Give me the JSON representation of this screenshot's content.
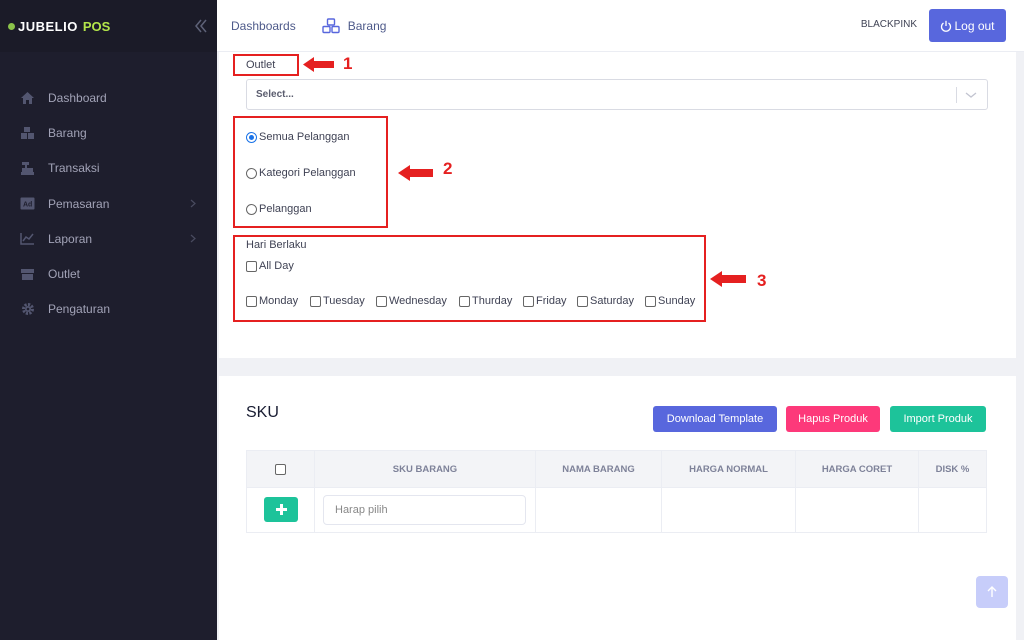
{
  "brand": {
    "name": "JUBELIO",
    "suffix": "POS"
  },
  "sidebar": {
    "items": [
      {
        "label": "Dashboard",
        "icon": "home-icon"
      },
      {
        "label": "Barang",
        "icon": "boxes-icon"
      },
      {
        "label": "Transaksi",
        "icon": "cash-register-icon"
      },
      {
        "label": "Pemasaran",
        "icon": "ad-icon",
        "has_submenu": true
      },
      {
        "label": "Laporan",
        "icon": "chart-line-icon",
        "has_submenu": true
      },
      {
        "label": "Outlet",
        "icon": "store-icon"
      },
      {
        "label": "Pengaturan",
        "icon": "gear-icon"
      }
    ]
  },
  "topbar": {
    "breadcrumb": [
      "Dashboards",
      "Barang"
    ],
    "user": "BLACKPINK",
    "logout_label": "Log out"
  },
  "form": {
    "outlet_label": "Outlet",
    "outlet_placeholder": "Select...",
    "customer_options": [
      {
        "label": "Semua Pelanggan",
        "checked": true
      },
      {
        "label": "Kategori Pelanggan",
        "checked": false
      },
      {
        "label": "Pelanggan",
        "checked": false
      }
    ],
    "days_label": "Hari Berlaku",
    "all_day_label": "All Day",
    "days": [
      "Monday",
      "Tuesday",
      "Wednesday",
      "Thurday",
      "Friday",
      "Saturday",
      "Sunday"
    ]
  },
  "annotations": [
    "1",
    "2",
    "3"
  ],
  "colors": {
    "annotation": "#e52020",
    "primary": "#5867dd",
    "danger": "#fd397a",
    "success": "#1dc39a",
    "sidebar": "#1e1e2d"
  },
  "sku": {
    "title": "SKU",
    "buttons": {
      "download": "Download Template",
      "hapus": "Hapus Produk",
      "import": "Import Produk"
    },
    "columns": [
      "SKU BARANG",
      "NAMA BARANG",
      "HARGA NORMAL",
      "HARGA CORET",
      "DISK %"
    ],
    "input_placeholder": "Harap pilih"
  }
}
